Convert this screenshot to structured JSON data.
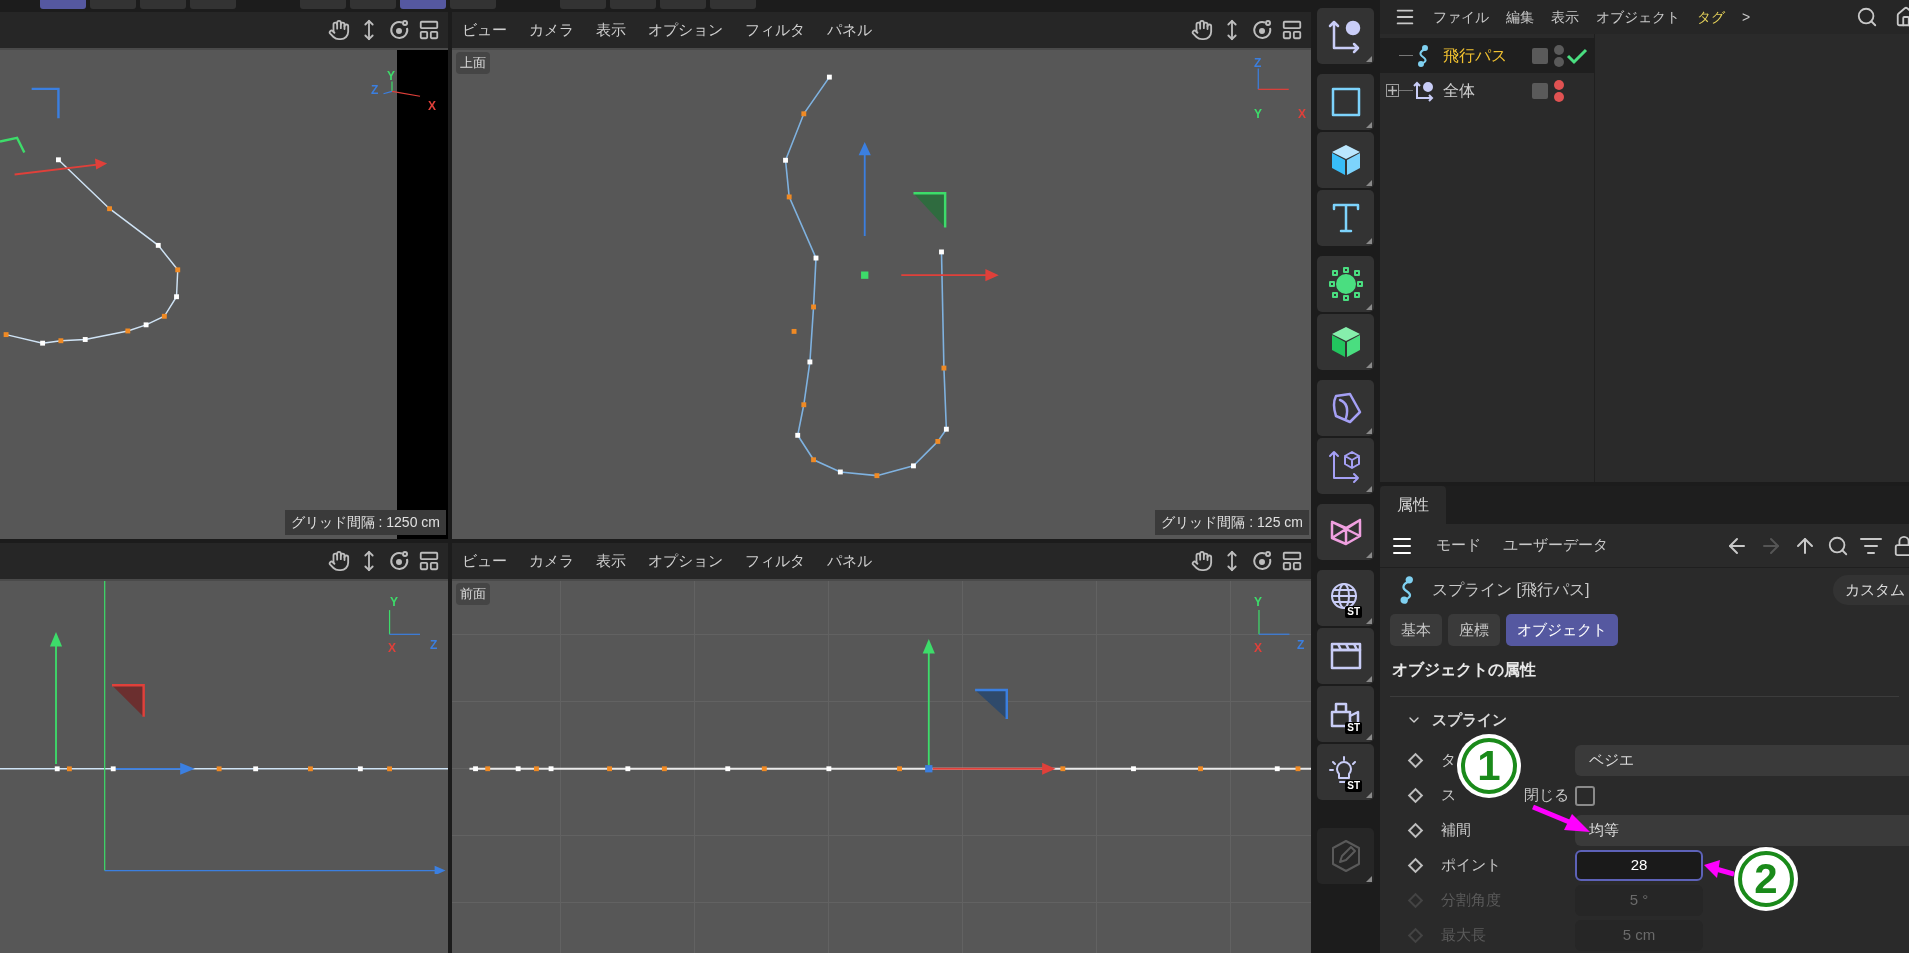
{
  "tool_strip": [
    {
      "selected": true
    },
    {
      "selected": false
    },
    {
      "selected": false
    },
    {
      "selected": false
    },
    {
      "selected": false
    },
    {
      "selected": false
    },
    {
      "selected": true
    },
    {
      "selected": false
    },
    {
      "selected": false
    },
    {
      "selected": false
    },
    {
      "selected": false
    },
    {
      "selected": false
    }
  ],
  "viewports": [
    {
      "grid_label": "グリッド間隔 : 1250 cm",
      "gizmo": [
        {
          "text": "Z",
          "color": "#3b7fe0"
        },
        {
          "text": "Y",
          "color": "#3ddc6a"
        },
        {
          "text": "X",
          "color": "#e0403a"
        }
      ]
    },
    {
      "menu": [
        "ビュー",
        "カメラ",
        "表示",
        "オプション",
        "フィルタ",
        "パネル"
      ],
      "label": "上面",
      "grid_label": "グリッド間隔 : 125 cm",
      "gizmo": [
        {
          "text": "Z",
          "color": "#3b7fe0"
        },
        {
          "text": "Y",
          "color": "#3ddc6a"
        },
        {
          "text": "X",
          "color": "#e0403a"
        }
      ]
    },
    {
      "gizmo": [
        {
          "text": "Y",
          "color": "#3ddc6a"
        },
        {
          "text": "X",
          "color": "#e0403a"
        },
        {
          "text": "Z",
          "color": "#3b7fe0"
        }
      ]
    },
    {
      "menu": [
        "ビュー",
        "カメラ",
        "表示",
        "オプション",
        "フィルタ",
        "パネル"
      ],
      "label": "前面",
      "gizmo": [
        {
          "text": "Y",
          "color": "#3ddc6a"
        },
        {
          "text": "X",
          "color": "#e0403a"
        },
        {
          "text": "Z",
          "color": "#3b7fe0"
        }
      ]
    }
  ],
  "toolbar": [
    [
      {
        "kind": "null"
      }
    ],
    [
      {
        "kind": "square"
      },
      {
        "kind": "cube"
      },
      {
        "kind": "text"
      }
    ],
    [
      {
        "kind": "generator"
      },
      {
        "kind": "greencube"
      }
    ],
    [
      {
        "kind": "deformer"
      },
      {
        "kind": "axiscube"
      }
    ],
    [
      {
        "kind": "bowtie"
      }
    ],
    [
      {
        "kind": "globe",
        "badge": "ST"
      },
      {
        "kind": "clapper"
      },
      {
        "kind": "camera",
        "badge": "ST"
      },
      {
        "kind": "bulb",
        "badge": "ST"
      }
    ],
    [
      {
        "kind": "edit",
        "disabled": true
      }
    ]
  ],
  "object_manager": {
    "menu": [
      {
        "label": "ファイル",
        "highlighted": false
      },
      {
        "label": "編集",
        "highlighted": false
      },
      {
        "label": "表示",
        "highlighted": false
      },
      {
        "label": "オブジェクト",
        "highlighted": false
      },
      {
        "label": "タグ",
        "highlighted": true
      }
    ],
    "more": ">",
    "objects": [
      {
        "name": "飛行パス",
        "kind": "spline",
        "selected": true,
        "color": "#5a5a5a",
        "check": true
      },
      {
        "name": "全体",
        "kind": "null",
        "selected": false,
        "expanded": false,
        "color": "#e05252",
        "check": false
      }
    ]
  },
  "attributes": {
    "tab": "属性",
    "menu": [
      "モード",
      "ユーザーデータ"
    ],
    "title": "スプライン [飛行パス]",
    "custom_button": "カスタム",
    "tabs": [
      {
        "label": "基本",
        "selected": false
      },
      {
        "label": "座標",
        "selected": false
      },
      {
        "label": "オブジェクト",
        "selected": true
      }
    ],
    "section": "オブジェクトの属性",
    "group": {
      "label": "スプライン",
      "expanded": true
    },
    "rows": [
      {
        "kind": "dropdown",
        "label": "タ",
        "value": "ベジエ",
        "disabled": false
      },
      {
        "kind": "checkbox",
        "label": "ス",
        "label_tail": "閉じる",
        "checked": false,
        "disabled": false
      },
      {
        "kind": "dropdown",
        "label": "補間",
        "value": "均等",
        "disabled": false
      },
      {
        "kind": "number",
        "label": "ポイント",
        "value": "28",
        "focused": true,
        "disabled": false
      },
      {
        "kind": "number",
        "label": "分割角度",
        "value": "5 °",
        "focused": false,
        "disabled": true
      },
      {
        "kind": "number",
        "label": "最大長",
        "value": "5 cm",
        "focused": false,
        "disabled": true
      }
    ]
  },
  "annotations": [
    {
      "text": "1"
    },
    {
      "text": "2"
    }
  ]
}
